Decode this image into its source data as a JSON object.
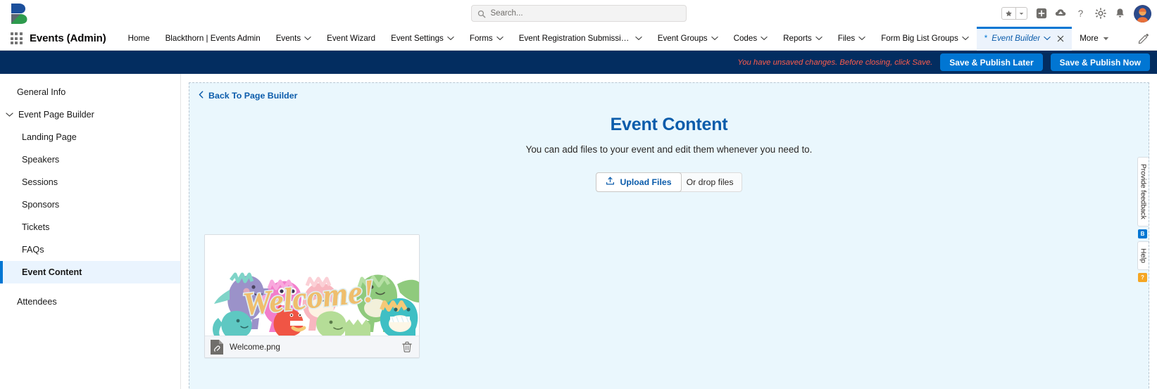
{
  "header": {
    "logo_name": "blackthorn-logo",
    "search_placeholder": "Search...",
    "search_icon": "search-icon",
    "favorites_icon": "star-icon",
    "favorites_caret_icon": "caret-down-icon",
    "add_icon": "plus-square-icon",
    "cloud_icon": "cloud-upload-icon",
    "help_icon": "question-mark-icon",
    "setup_icon": "gear-icon",
    "notifications_icon": "bell-icon",
    "avatar_icon": "user-avatar"
  },
  "appnav": {
    "waffle_icon": "app-launcher-icon",
    "app_name": "Events (Admin)",
    "items": [
      {
        "label": "Home",
        "has_caret": false,
        "active": false
      },
      {
        "label": "Blackthorn | Events Admin",
        "has_caret": false,
        "active": false
      },
      {
        "label": "Events",
        "has_caret": true,
        "active": false
      },
      {
        "label": "Event Wizard",
        "has_caret": false,
        "active": false
      },
      {
        "label": "Event Settings",
        "has_caret": true,
        "active": false
      },
      {
        "label": "Forms",
        "has_caret": true,
        "active": false
      },
      {
        "label": "Event Registration Submissio...",
        "has_caret": true,
        "active": false
      },
      {
        "label": "Event Groups",
        "has_caret": true,
        "active": false
      },
      {
        "label": "Codes",
        "has_caret": true,
        "active": false
      },
      {
        "label": "Reports",
        "has_caret": true,
        "active": false
      },
      {
        "label": "Files",
        "has_caret": true,
        "active": false
      },
      {
        "label": "Form Big List Groups",
        "has_caret": true,
        "active": false
      },
      {
        "label": "Event Builder",
        "has_caret": true,
        "active": true,
        "unsaved_marker": "*",
        "closable": true
      }
    ],
    "more_label": "More",
    "more_caret_icon": "caret-down-filled-icon",
    "edit_icon": "pencil-icon"
  },
  "savebar": {
    "unsaved_message": "You have unsaved changes. Before closing, click Save.",
    "save_later_label": "Save & Publish Later",
    "save_now_label": "Save & Publish Now",
    "accent_color": "#0176d3",
    "bar_color": "#032d60",
    "warning_color": "#fe5c4c"
  },
  "sidebar": {
    "items": [
      {
        "label": "General Info",
        "level": 0,
        "expandable": false,
        "selected": false
      },
      {
        "label": "Event Page Builder",
        "level": 0,
        "expandable": true,
        "expanded": true,
        "selected": false,
        "chevron_icon": "chevron-down-icon"
      },
      {
        "label": "Landing Page",
        "level": 1,
        "expandable": false,
        "selected": false
      },
      {
        "label": "Speakers",
        "level": 1,
        "expandable": false,
        "selected": false
      },
      {
        "label": "Sessions",
        "level": 1,
        "expandable": false,
        "selected": false
      },
      {
        "label": "Sponsors",
        "level": 1,
        "expandable": false,
        "selected": false
      },
      {
        "label": "Tickets",
        "level": 1,
        "expandable": false,
        "selected": false
      },
      {
        "label": "FAQs",
        "level": 1,
        "expandable": false,
        "selected": false
      },
      {
        "label": "Event Content",
        "level": 1,
        "expandable": false,
        "selected": true
      },
      {
        "label": "Attendees",
        "level": 0,
        "expandable": false,
        "selected": false
      }
    ]
  },
  "main": {
    "back_link": "Back To Page Builder",
    "back_icon": "chevron-left-icon",
    "title": "Event Content",
    "subtitle": "You can add files to your event and edit them whenever you need to.",
    "upload_button": "Upload Files",
    "upload_icon": "upload-icon",
    "drop_hint": "Or drop files",
    "title_color": "#0b5cab",
    "canvas_bg": "#eaf7fd"
  },
  "file_card": {
    "file_name": "Welcome.png",
    "file_icon": "attachment-file-icon",
    "delete_icon": "trash-icon",
    "thumbnail_alt": "Welcome dinosaurs illustration"
  },
  "rail": {
    "feedback_label": "Provide feedback",
    "feedback_badge": "B",
    "feedback_badge_color": "#0176d3",
    "help_label": "Help",
    "help_badge": "?",
    "help_badge_color": "#f5a623"
  }
}
